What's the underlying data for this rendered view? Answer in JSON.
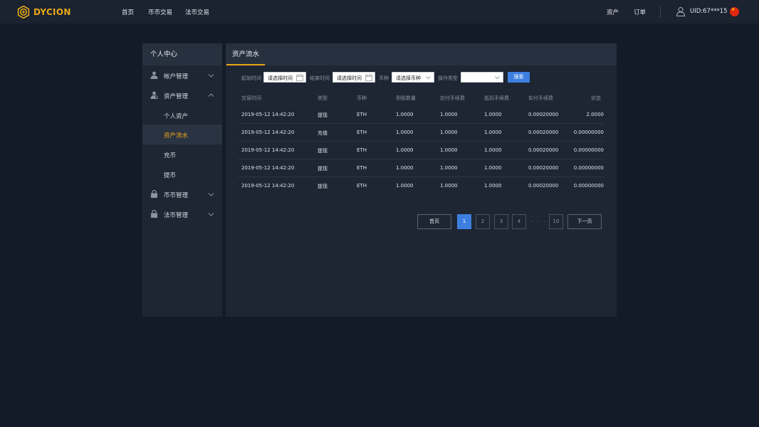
{
  "header": {
    "logo_text": "DYCION",
    "nav": [
      "首页",
      "币币交易",
      "法币交易"
    ],
    "right_links": [
      "资产",
      "订单"
    ],
    "uid": "UID:67***15",
    "brand_color": "#e8a916"
  },
  "sidebar": {
    "title": "个人中心",
    "groups": [
      {
        "label": "帐户管理",
        "icon": "user-icon"
      },
      {
        "label": "资产管理",
        "icon": "wallet-user-icon"
      },
      {
        "label": "币币管理",
        "icon": "lock-icon"
      },
      {
        "label": "法币管理",
        "icon": "lock-icon"
      }
    ],
    "sub_items": [
      "个人资产",
      "资产流水",
      "充币",
      "提币"
    ],
    "active_sub": "资产流水"
  },
  "panel": {
    "tab": "资产流水",
    "filters": {
      "start_label": "起始时间",
      "start_value": "请选择时间",
      "end_label": "结束时间",
      "end_value": "请选择时间",
      "coin_label": "币种",
      "coin_value": "请选择币种",
      "op_label": "操作类型",
      "op_value": "",
      "search_label": "搜索"
    },
    "columns": [
      "交易时间",
      "类型",
      "币种",
      "到账数量",
      "应付手续费",
      "抵扣手续费",
      "实付手续费",
      "状态"
    ],
    "rows": [
      [
        "2019-05-12 14:42:20",
        "提现",
        "ETH",
        "1.0000",
        "1.0000",
        "1.0000",
        "0.00020000",
        "2.0000"
      ],
      [
        "2019-05-12 14:42:20",
        "充值",
        "ETH",
        "1.0000",
        "1.0000",
        "1.0000",
        "0.00020000",
        "0.00000000"
      ],
      [
        "2019-05-12 14:42:20",
        "提现",
        "ETH",
        "1.0000",
        "1.0000",
        "1.0000",
        "0.00020000",
        "0.00000000"
      ],
      [
        "2019-05-12 14:42:20",
        "提现",
        "ETH",
        "1.0000",
        "1.0000",
        "1.0000",
        "0.00020000",
        "0.00000000"
      ],
      [
        "2019-05-12 14:42:20",
        "提现",
        "ETH",
        "1.0000",
        "1.0000",
        "1.0000",
        "0.00020000",
        "0.00000000"
      ]
    ],
    "pagination": {
      "first": "首页",
      "pages": [
        "1",
        "2",
        "3",
        "4"
      ],
      "dots": "· · ·",
      "last_page": "10",
      "next": "下一页",
      "current": "1"
    }
  }
}
